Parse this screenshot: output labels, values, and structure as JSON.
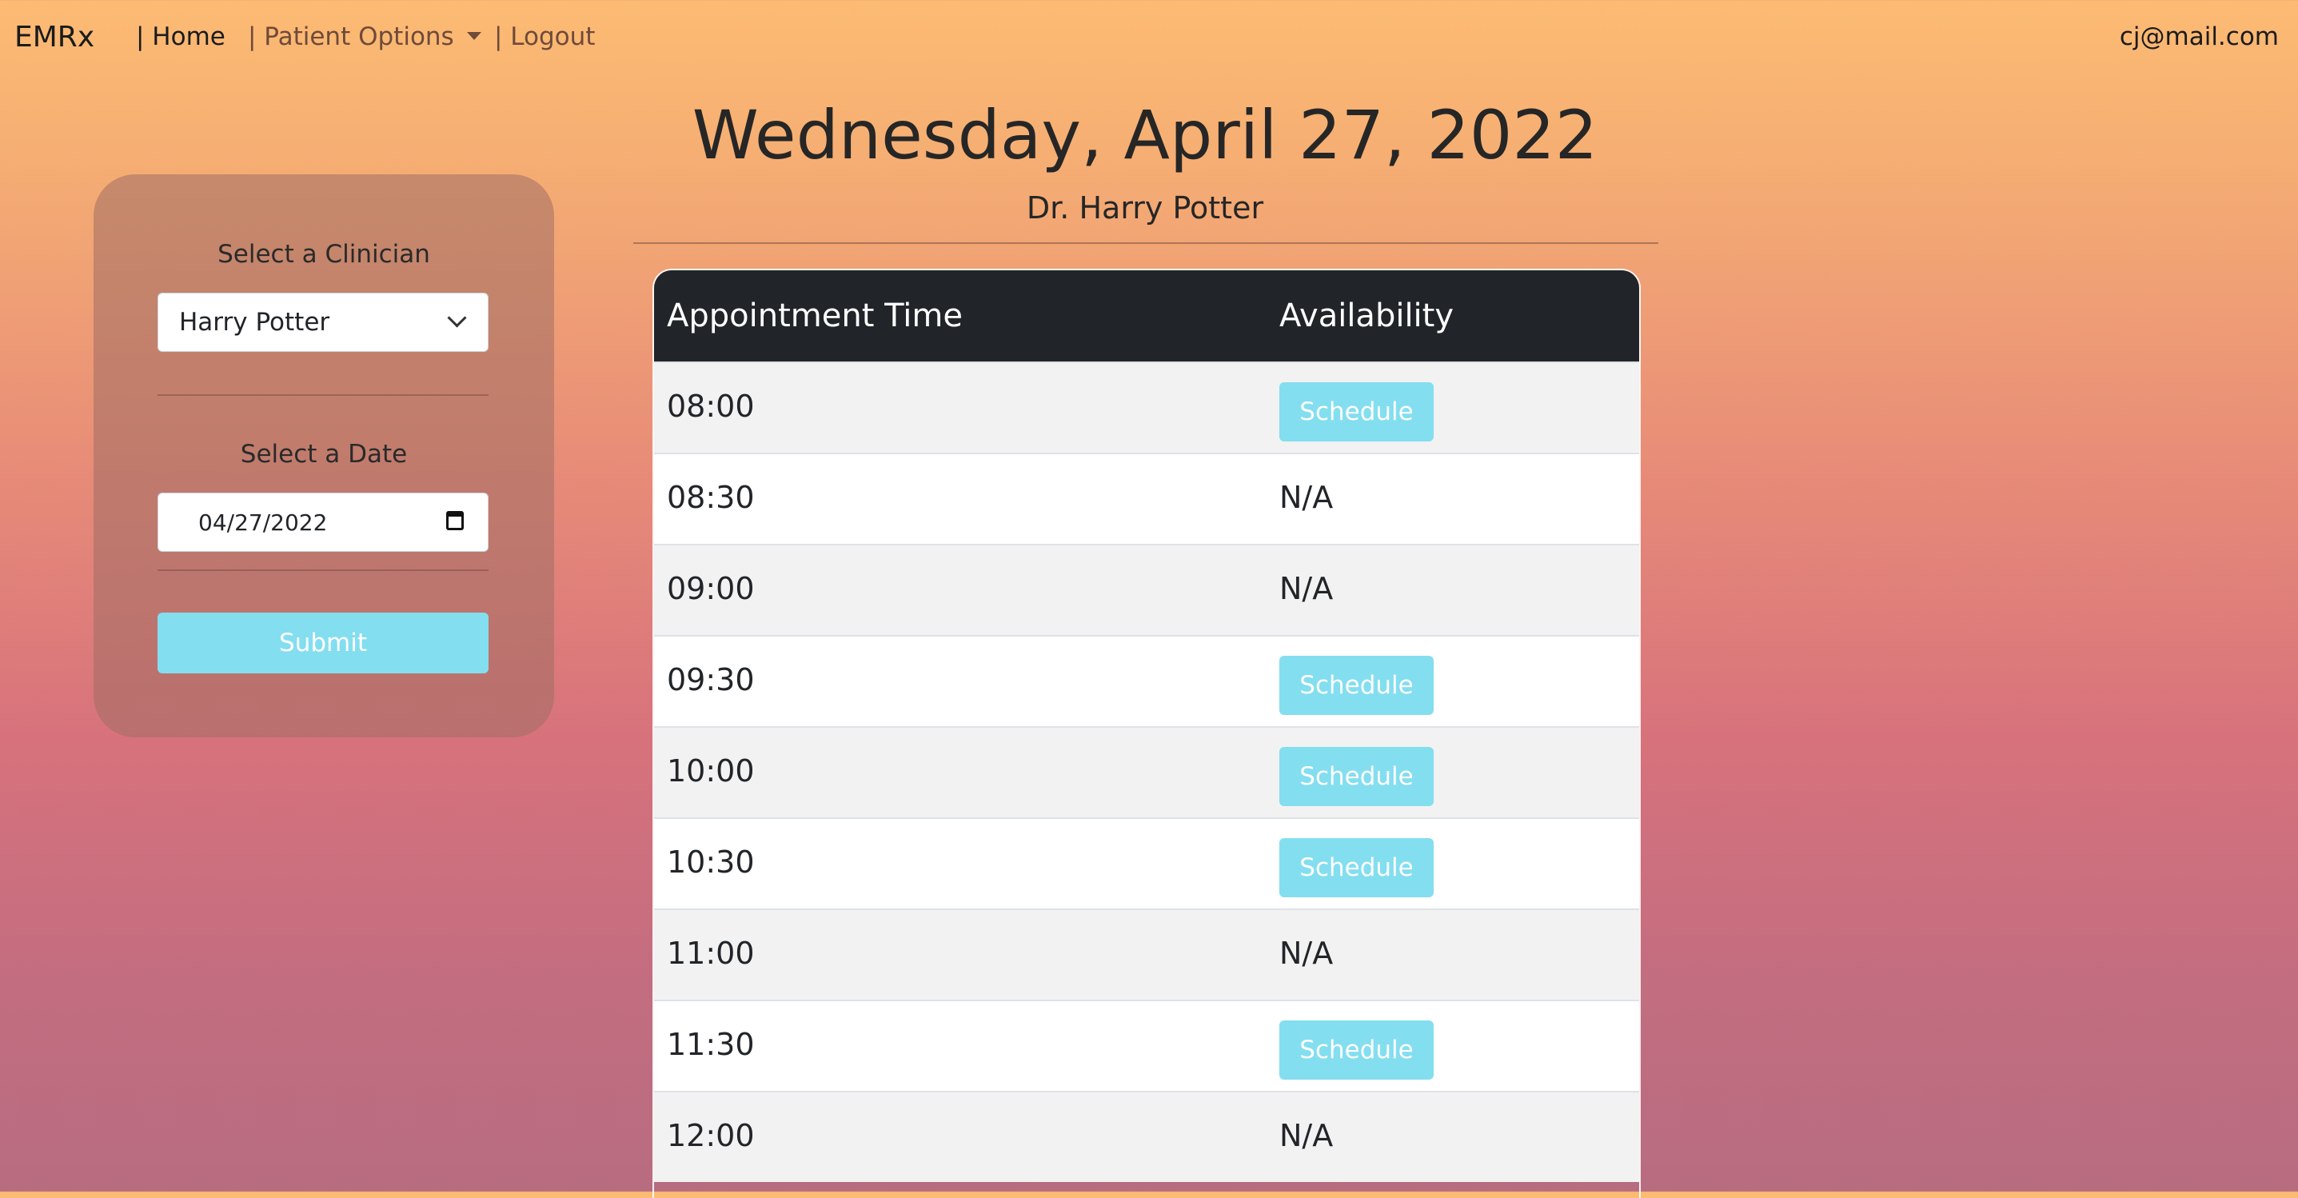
{
  "nav": {
    "brand": "EMRx",
    "home": "| Home",
    "patient_options": "| Patient Options",
    "logout": "| Logout",
    "user_email": "cj@mail.com"
  },
  "form": {
    "clinician_label": "Select a Clinician",
    "clinician_value": "Harry Potter",
    "date_label": "Select a Date",
    "date_value": "04/27/2022",
    "submit_label": "Submit"
  },
  "schedule": {
    "date_heading": "Wednesday, April 27, 2022",
    "doctor_name": "Dr. Harry Potter",
    "columns": [
      "Appointment Time",
      "Availability"
    ],
    "schedule_label": "Schedule",
    "rows": [
      {
        "time": "08:00",
        "availability": "Schedule"
      },
      {
        "time": "08:30",
        "availability": "N/A"
      },
      {
        "time": "09:00",
        "availability": "N/A"
      },
      {
        "time": "09:30",
        "availability": "Schedule"
      },
      {
        "time": "10:00",
        "availability": "Schedule"
      },
      {
        "time": "10:30",
        "availability": "Schedule"
      },
      {
        "time": "11:00",
        "availability": "N/A"
      },
      {
        "time": "11:30",
        "availability": "Schedule"
      },
      {
        "time": "12:00",
        "availability": "N/A"
      }
    ]
  },
  "colors": {
    "accent_button": "#83def0",
    "table_header": "#212529"
  }
}
